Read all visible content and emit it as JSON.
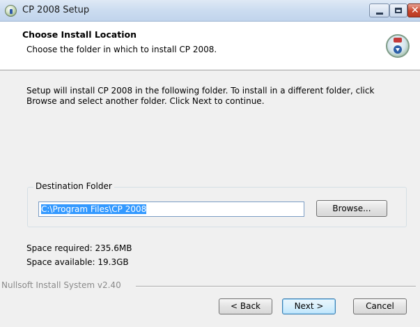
{
  "window": {
    "title": "CP 2008 Setup"
  },
  "header": {
    "title": "Choose Install Location",
    "subtitle": "Choose the folder in which to install CP 2008."
  },
  "body": {
    "description": "Setup will install CP 2008 in the following folder. To install in a different folder, click Browse and select another folder. Click Next to continue.",
    "destination_label": "Destination Folder",
    "destination_value": "C:\\Program Files\\CP 2008",
    "browse_label": "Browse...",
    "space_required": "Space required: 235.6MB",
    "space_available": "Space available: 19.3GB"
  },
  "footer": {
    "branding": "Nullsoft Install System v2.40",
    "back_label": "< Back",
    "next_label": "Next >",
    "cancel_label": "Cancel"
  },
  "colors": {
    "selection": "#3399ff",
    "default_button_border": "#3c7fb1"
  },
  "icons": {
    "app": "installer-disc-icon",
    "header": "install-disc-icon"
  }
}
